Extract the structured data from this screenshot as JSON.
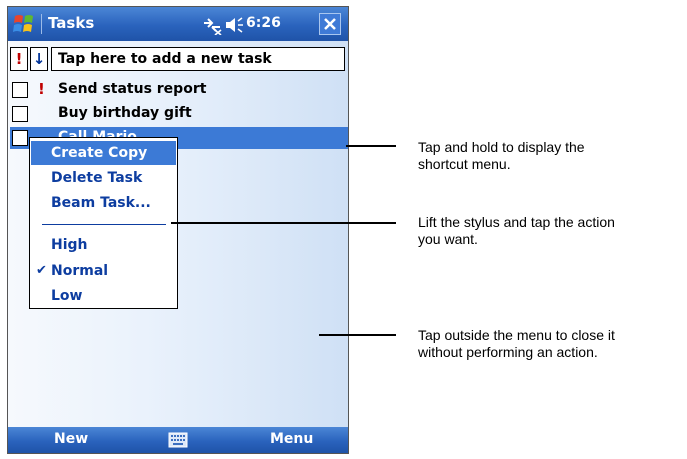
{
  "titlebar": {
    "app_title": "Tasks",
    "clock": "6:26",
    "icons": [
      "windows-start-icon",
      "connectivity-icon",
      "volume-icon",
      "close-icon"
    ]
  },
  "entry_bar": {
    "priority_symbol": "!",
    "sort_symbol": "↓",
    "add_task_text": "Tap here to add a new task"
  },
  "tasks": [
    {
      "label": "Send status report",
      "high_priority": true
    },
    {
      "label": "Buy birthday gift",
      "high_priority": false
    },
    {
      "label": "Call Mario",
      "high_priority": false,
      "selected": true
    }
  ],
  "context_menu": {
    "items": [
      "Create Copy",
      "Delete Task",
      "Beam Task..."
    ],
    "priority_items": [
      "High",
      "Normal",
      "Low"
    ],
    "checked": "Normal",
    "highlighted": "Create Copy",
    "check_mark": "✔"
  },
  "bottombar": {
    "left_label": "New",
    "right_label": "Menu"
  },
  "callouts": [
    "Tap and hold to display the\nshortcut menu.",
    "Lift the stylus and tap the action\nyou want.",
    "Tap outside the menu to close it\nwithout performing an action."
  ],
  "colors": {
    "titlebar_blue": "#2a63bd",
    "selection_blue": "#3c7ad6",
    "menu_text_blue": "#0d3da0",
    "priority_red": "#c00000"
  }
}
